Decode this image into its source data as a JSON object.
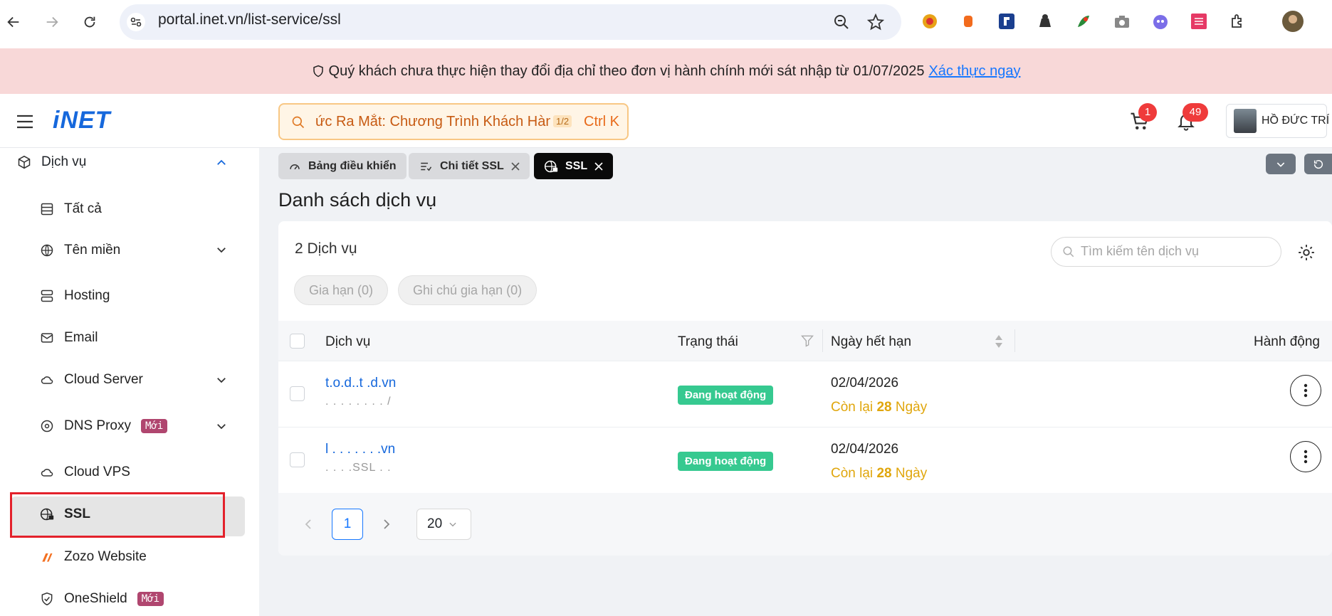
{
  "browser": {
    "url": "portal.inet.vn/list-service/ssl"
  },
  "banner": {
    "message": "Quý khách chưa thực hiện thay đổi địa chỉ theo đơn vị hành chính mới sát nhập từ 01/07/2025",
    "link": "Xác thực ngay"
  },
  "header": {
    "logo": "iNET",
    "promo_text": "ức Ra Mắt: Chương Trình Khách Hàng",
    "promo_counter": "1/2",
    "promo_shortcut": "Ctrl K",
    "cart_count": "1",
    "notification_count": "49",
    "user_name": "HỒ ĐỨC TRÍ"
  },
  "sidebar": {
    "section": "Dịch vụ",
    "items": [
      {
        "label": "Tất cả"
      },
      {
        "label": "Tên miền"
      },
      {
        "label": "Hosting"
      },
      {
        "label": "Email"
      },
      {
        "label": "Cloud Server"
      },
      {
        "label": "DNS Proxy",
        "badge": "Mới"
      },
      {
        "label": "Cloud VPS"
      },
      {
        "label": "SSL",
        "active": true
      },
      {
        "label": "Zozo Website"
      },
      {
        "label": "OneShield",
        "badge": "Mới"
      }
    ]
  },
  "tabs": [
    {
      "label": "Bảng điều khiển"
    },
    {
      "label": "Chi tiết SSL"
    },
    {
      "label": "SSL",
      "active": true
    }
  ],
  "page": {
    "title": "Danh sách dịch vụ",
    "count": "2 Dịch vụ",
    "search_placeholder": "Tìm kiếm tên dịch vụ",
    "renew_button": "Gia hạn (0)",
    "renew_note_button": "Ghi chú gia hạn (0)"
  },
  "table": {
    "columns": [
      "Dịch vụ",
      "Trạng thái",
      "Ngày hết hạn",
      "Hành động"
    ],
    "rows": [
      {
        "service": "t.o.d..t .d.vn",
        "sub": ". . . . . . . . /",
        "status": "Đang hoạt động",
        "expiry": "02/04/2026",
        "remain_prefix": "Còn lại",
        "remain_days": "28",
        "remain_suffix": "Ngày"
      },
      {
        "service": "l . . . . . . .vn",
        "sub": ". . . .SSL . .",
        "status": "Đang hoạt động",
        "expiry": "02/04/2026",
        "remain_prefix": "Còn lại",
        "remain_days": "28",
        "remain_suffix": "Ngày"
      }
    ]
  },
  "pagination": {
    "current_page": "1",
    "page_size": "20"
  },
  "colors": {
    "brand": "#1668dc",
    "status_active": "#36c990",
    "highlight": "#e3212b"
  }
}
